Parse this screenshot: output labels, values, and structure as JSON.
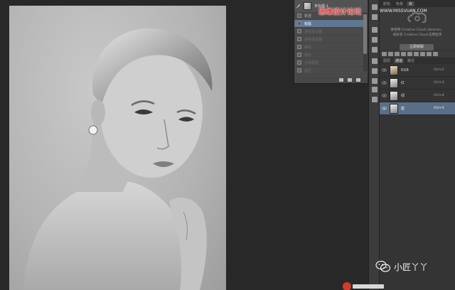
{
  "history": {
    "snapshot_label": "未标题-1",
    "items": [
      {
        "label": "新建",
        "state": "normal"
      },
      {
        "label": "粘贴",
        "state": "active"
      },
      {
        "label": "通道混合器",
        "state": "dim"
      },
      {
        "label": "通道混合器",
        "state": "dim"
      },
      {
        "label": "曲线",
        "state": "dim"
      },
      {
        "label": "色阶",
        "state": "dim"
      },
      {
        "label": "合并图层",
        "state": "dim"
      },
      {
        "label": "选区",
        "state": "dim"
      }
    ]
  },
  "panel_tabs": [
    "颜色",
    "色板",
    "库"
  ],
  "creative_cloud": {
    "line1": "要使用 Creative Cloud Libraries，",
    "line2": "请安装 Creative Cloud 应用程序",
    "button": "立即获取"
  },
  "channel_tabs": [
    "图层",
    "通道",
    "路径"
  ],
  "channels": [
    {
      "name": "RGB",
      "key": "Ctrl+2",
      "thumb": "color",
      "active": false
    },
    {
      "name": "红",
      "key": "Ctrl+3",
      "thumb": "gray",
      "active": false
    },
    {
      "name": "绿",
      "key": "Ctrl+4",
      "thumb": "gray",
      "active": false
    },
    {
      "name": "蓝",
      "key": "Ctrl+5",
      "thumb": "gray",
      "active": true
    }
  ],
  "watermark": {
    "site_cn": "思缘设计论坛",
    "site_url": "WWW.MISSVUAN.COM",
    "wechat": "小匠丫丫"
  },
  "colors": {
    "selection": "#5f7797",
    "watermark_red": "#d83a3a"
  },
  "icons": {
    "strip": [
      "history-icon",
      "play-icon",
      "info-icon",
      "swatches-icon",
      "adjust-icon",
      "brush-icon",
      "clone-icon",
      "paragraph-icon",
      "type-icon",
      "3d-icon",
      "timeline-icon"
    ]
  }
}
